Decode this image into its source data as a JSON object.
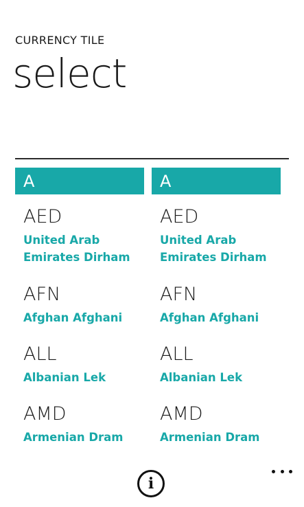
{
  "header": {
    "app_name": "CURRENCY TILE",
    "page_title": "select"
  },
  "columns": [
    {
      "group_letter": "A",
      "items": [
        {
          "code": "AED",
          "name": "United Arab Emirates Dirham"
        },
        {
          "code": "AFN",
          "name": "Afghan Afghani"
        },
        {
          "code": "ALL",
          "name": "Albanian Lek"
        },
        {
          "code": "AMD",
          "name": "Armenian Dram"
        }
      ]
    },
    {
      "group_letter": "A",
      "items": [
        {
          "code": "AED",
          "name": "United Arab Emirates Dirham"
        },
        {
          "code": "AFN",
          "name": "Afghan Afghani"
        },
        {
          "code": "ALL",
          "name": "Albanian Lek"
        },
        {
          "code": "AMD",
          "name": "Armenian Dram"
        }
      ]
    }
  ],
  "app_bar": {
    "info_icon": "info-icon",
    "more_icon": "more-icon",
    "info_glyph": "i"
  },
  "colors": {
    "accent": "#18a8a8",
    "text": "#1a1a1a",
    "background": "#ffffff"
  }
}
